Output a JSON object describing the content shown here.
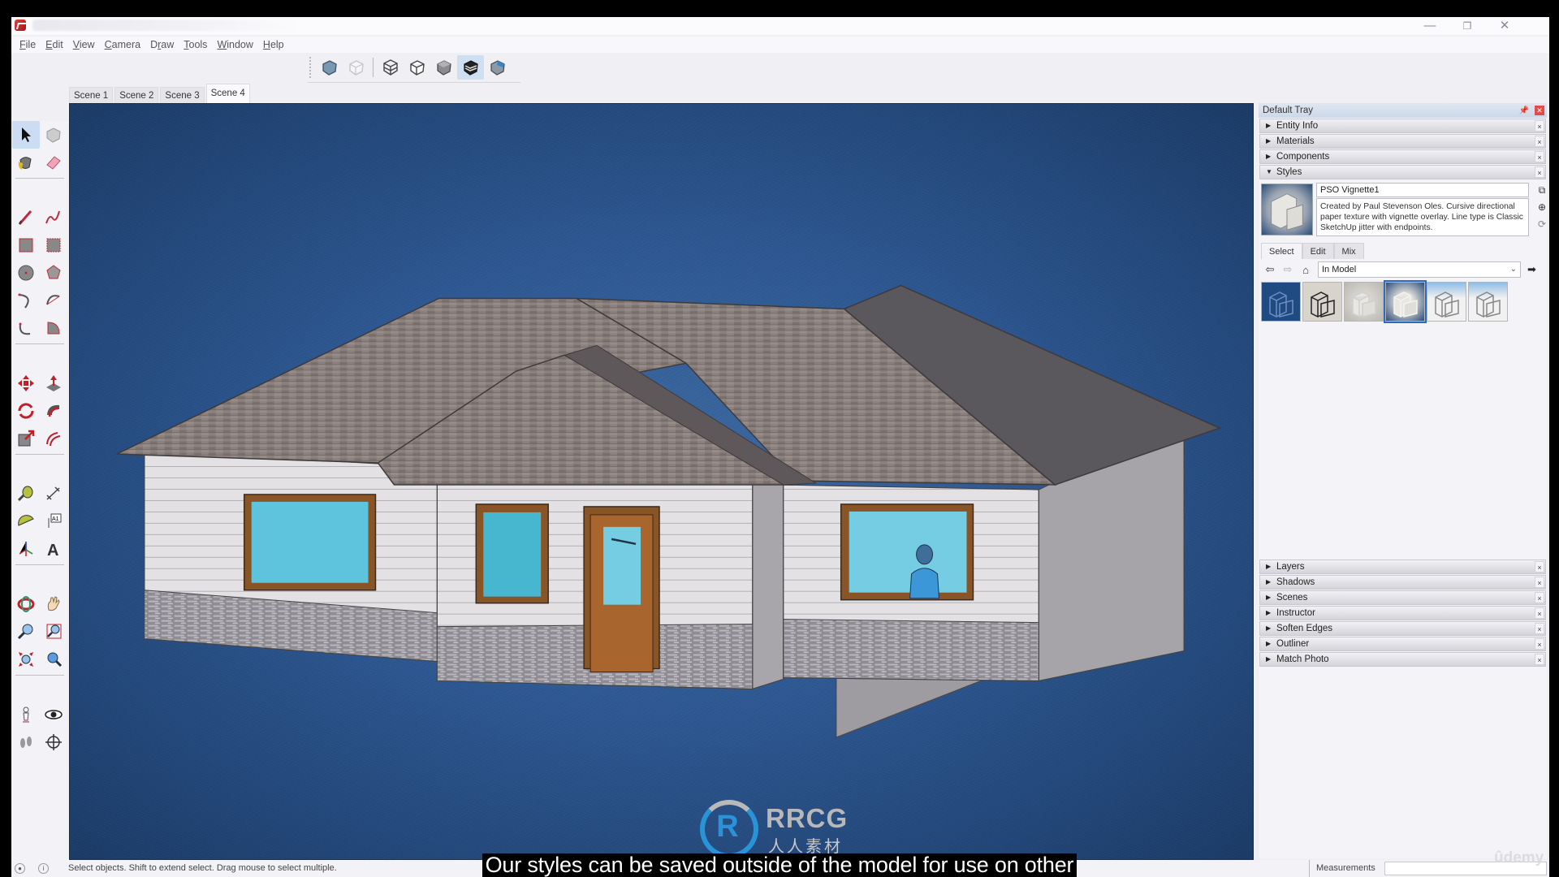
{
  "app": {
    "name": "SketchUp",
    "window_controls": {
      "minimize": "—",
      "maximize": "❐",
      "close": "✕"
    }
  },
  "menu": [
    {
      "label": "File",
      "accel": "F"
    },
    {
      "label": "Edit",
      "accel": "E"
    },
    {
      "label": "View",
      "accel": "V"
    },
    {
      "label": "Camera",
      "accel": "C"
    },
    {
      "label": "Draw",
      "accel": "r"
    },
    {
      "label": "Tools",
      "accel": "T"
    },
    {
      "label": "Window",
      "accel": "W"
    },
    {
      "label": "Help",
      "accel": "H"
    }
  ],
  "style_toolbar": {
    "buttons": [
      {
        "name": "x-ray",
        "icon": "xray-cube-icon",
        "active": false
      },
      {
        "name": "back-edges",
        "icon": "back-edges-cube-icon",
        "active": false
      },
      {
        "name": "wireframe",
        "icon": "wireframe-cube-icon",
        "active": false
      },
      {
        "name": "hidden-line",
        "icon": "hidden-line-cube-icon",
        "active": false
      },
      {
        "name": "shaded",
        "icon": "shaded-cube-icon",
        "active": false
      },
      {
        "name": "shaded-with-textures",
        "icon": "textured-cube-icon",
        "active": true
      },
      {
        "name": "monochrome",
        "icon": "monochrome-cube-icon",
        "active": false
      }
    ]
  },
  "scenes": {
    "tabs": [
      "Scene 1",
      "Scene 2",
      "Scene 3",
      "Scene 4"
    ],
    "active_index": 3
  },
  "left_toolbar": {
    "tools": [
      "select",
      "make-component",
      "paint-bucket",
      "eraser",
      "line",
      "freehand",
      "rectangle",
      "rotated-rectangle",
      "circle",
      "polygon",
      "arc",
      "2-point-arc",
      "3-point-arc",
      "pie",
      "move",
      "push-pull",
      "rotate",
      "follow-me",
      "scale",
      "offset",
      "tape-measure",
      "dimension",
      "protractor",
      "text",
      "axes",
      "3d-text",
      "orbit",
      "pan",
      "zoom",
      "zoom-window",
      "zoom-extents",
      "previous-view",
      "position-camera",
      "look-around",
      "walk",
      "section-plane"
    ],
    "active": "select"
  },
  "tray": {
    "title": "Default Tray",
    "panels_top": [
      {
        "label": "Entity Info",
        "expanded": false
      },
      {
        "label": "Materials",
        "expanded": false
      },
      {
        "label": "Components",
        "expanded": false
      },
      {
        "label": "Styles",
        "expanded": true
      }
    ],
    "styles": {
      "name": "PSO Vignette1",
      "description": "Created by Paul Stevenson Oles.   Cursive directional paper texture with vignette overlay. Line type is Classic SketchUp jitter with endpoints.",
      "tabs": [
        "Select",
        "Edit",
        "Mix"
      ],
      "active_tab": "Select",
      "collection": "In Model",
      "swatches": [
        {
          "name": "Blueprint style",
          "selected": false
        },
        {
          "name": "Sketchy marker style",
          "selected": false
        },
        {
          "name": "Vignette paper style",
          "selected": false
        },
        {
          "name": "PSO Vignette1",
          "selected": true
        },
        {
          "name": "Sky sketch style",
          "selected": false
        },
        {
          "name": "Sky sketch style 2",
          "selected": false
        }
      ]
    },
    "panels_bottom": [
      {
        "label": "Layers",
        "expanded": false
      },
      {
        "label": "Shadows",
        "expanded": false
      },
      {
        "label": "Scenes",
        "expanded": false
      },
      {
        "label": "Instructor",
        "expanded": false
      },
      {
        "label": "Soften Edges",
        "expanded": false
      },
      {
        "label": "Outliner",
        "expanded": false
      },
      {
        "label": "Match Photo",
        "expanded": false
      }
    ]
  },
  "statusbar": {
    "hint": "Select objects. Shift to extend select. Drag mouse to select multiple.",
    "measurements_label": "Measurements",
    "measurements_value": ""
  },
  "overlays": {
    "caption": "Our styles can be saved outside of the model for use on other",
    "watermark_title": "RRCG",
    "watermark_subtitle": "人人素材",
    "watermark_logo": "R",
    "corner_brand": "ûdemy"
  },
  "colors": {
    "viewport_bg": "#2d5791",
    "roof": "#8a7f7c",
    "roof_shadow": "#5e5a5d",
    "siding": "#e3e0e3",
    "brick": "#8d8b91",
    "window_glass": "#5fc3dc",
    "window_frame": "#8a5526",
    "door": "#a8652e",
    "selection_highlight": "#2f6bbd"
  }
}
